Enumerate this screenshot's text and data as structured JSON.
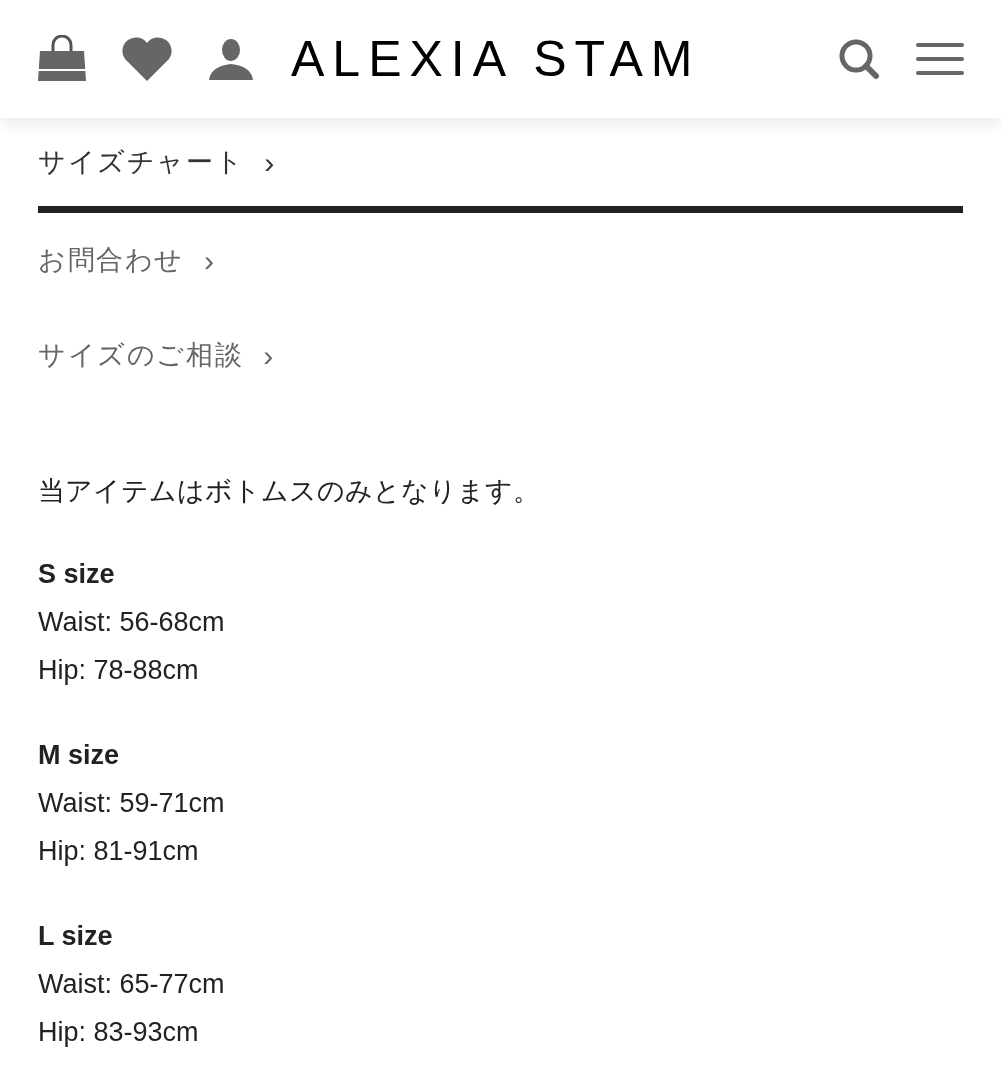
{
  "header": {
    "logo": "ALEXIA STAM"
  },
  "links": [
    {
      "label": "サイズチャート",
      "arrow": "›",
      "selected": true
    },
    {
      "label": "お問合わせ",
      "arrow": "›",
      "selected": false
    },
    {
      "label": "サイズのご相談",
      "arrow": "›",
      "selected": false
    }
  ],
  "note": "当アイテムはボトムスのみとなります。",
  "sizes": [
    {
      "title": "S size",
      "lines": [
        "Waist: 56-68cm",
        "Hip: 78-88cm"
      ]
    },
    {
      "title": "M size",
      "lines": [
        "Waist: 59-71cm",
        "Hip: 81-91cm"
      ]
    },
    {
      "title": "L size",
      "lines": [
        "Waist: 65-77cm",
        "Hip: 83-93cm"
      ]
    }
  ]
}
